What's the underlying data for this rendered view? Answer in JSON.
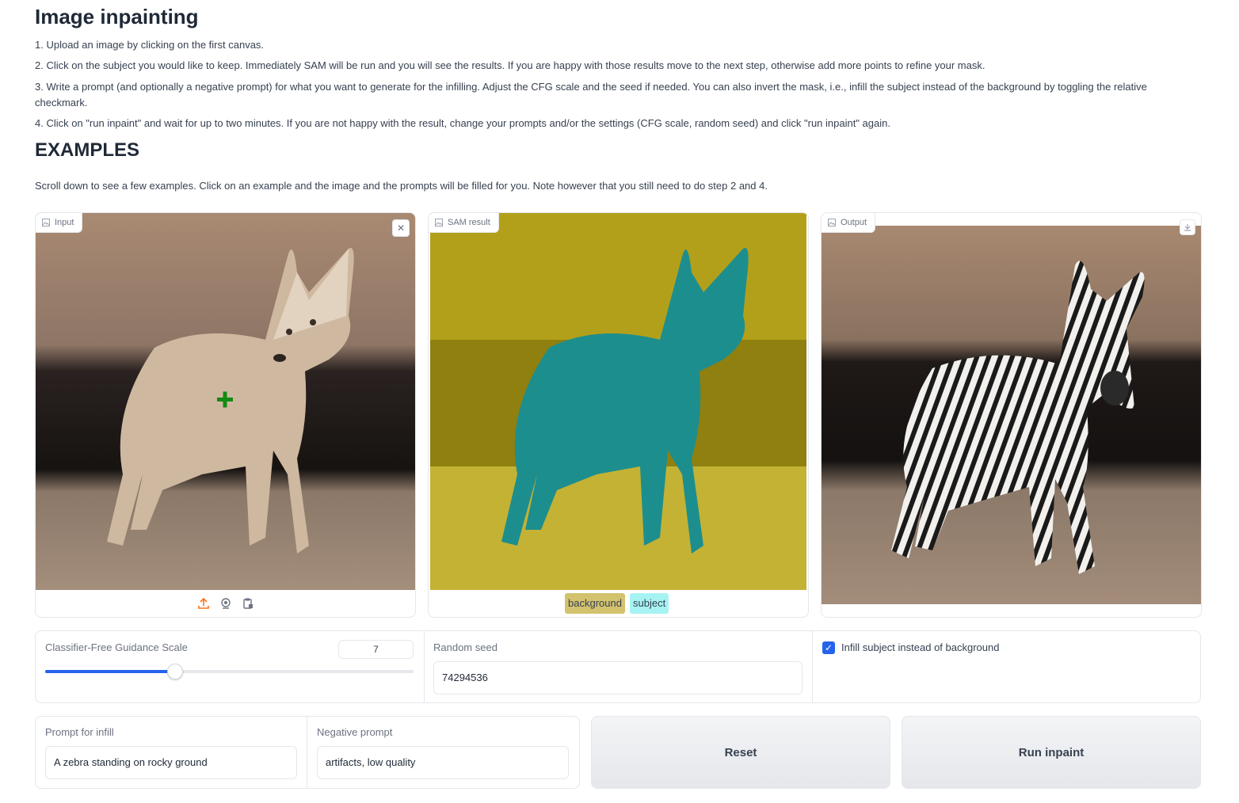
{
  "page": {
    "title": "Image inpainting",
    "steps": [
      "1. Upload an image by clicking on the first canvas.",
      "2. Click on the subject you would like to keep. Immediately SAM will be run and you will see the results. If you are happy with those results move to the next step, otherwise add more points to refine your mask.",
      "3. Write a prompt (and optionally a negative prompt) for what you want to generate for the infilling. Adjust the CFG scale and the seed if needed. You can also invert the mask, i.e., infill the subject instead of the background by toggling the relative checkmark.",
      "4. Click on \"run inpaint\" and wait for up to two minutes. If you are not happy with the result, change your prompts and/or the settings (CFG scale, random seed) and click \"run inpaint\" again."
    ],
    "examples_heading": "EXAMPLES",
    "examples_note": "Scroll down to see a few examples. Click on an example and the image and the prompts will be filled for you. Note however that you still need to do step 2 and 4."
  },
  "panels": {
    "input_label": "Input",
    "sam_label": "SAM result",
    "output_label": "Output"
  },
  "legend": {
    "background": "background",
    "subject": "subject",
    "background_color": "#d3c26e",
    "subject_color": "#a7f3f3"
  },
  "controls": {
    "cfg_label": "Classifier-Free Guidance Scale",
    "cfg_value": "7",
    "cfg_fraction": 0.35,
    "seed_label": "Random seed",
    "seed_value": "74294536",
    "invert_label": "Infill subject instead of background",
    "invert_checked": true,
    "prompt_label": "Prompt for infill",
    "prompt_value": "A zebra standing on rocky ground",
    "neg_label": "Negative prompt",
    "neg_value": "artifacts, low quality"
  },
  "buttons": {
    "reset": "Reset",
    "run": "Run inpaint"
  },
  "colors": {
    "accent": "#2563eb",
    "sam_background": "#b3a01a",
    "sam_subject": "#1d8e8e",
    "upload_icon": "#f97316",
    "point_marker": "#138a13"
  }
}
